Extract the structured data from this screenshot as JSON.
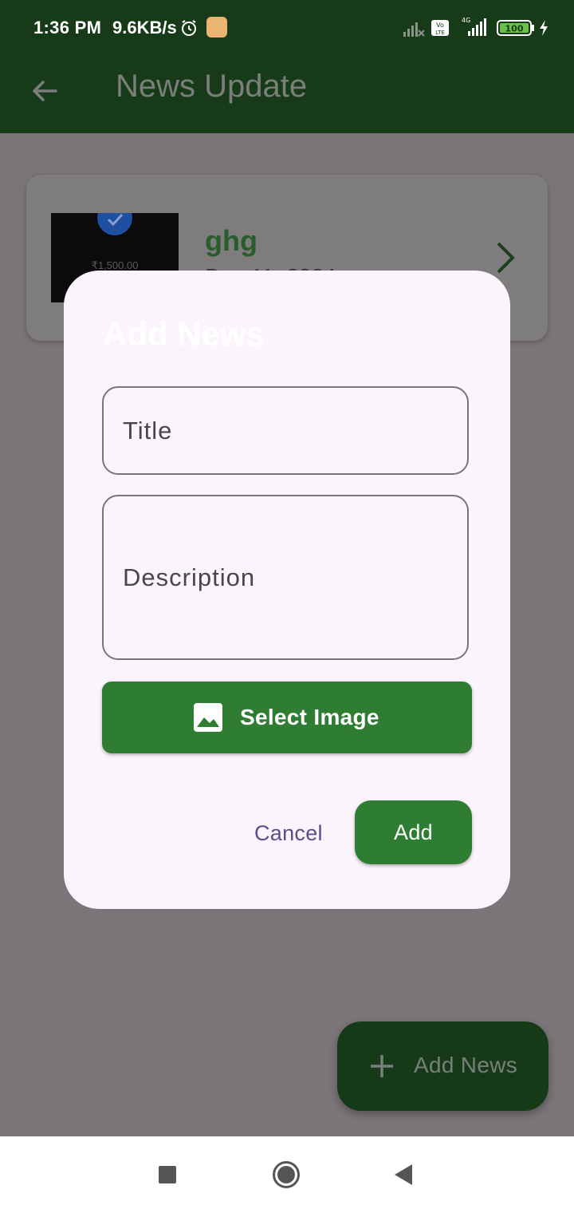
{
  "status_bar": {
    "time": "1:36 PM",
    "net_speed": "9.6KB/s",
    "battery_level": "100",
    "icons": [
      "alarm-icon",
      "app-notification-icon",
      "signal-icon",
      "volte-icon",
      "signal-4g-icon",
      "battery-icon",
      "charging-icon"
    ]
  },
  "app_bar": {
    "title": "News Update",
    "back_icon": "arrow-left-icon"
  },
  "news_list": [
    {
      "title": "ghg",
      "date": "Dec 11, 2024",
      "thumb_text": "₹1,500.00"
    }
  ],
  "fab": {
    "label": "Add News",
    "icon": "plus-icon"
  },
  "dialog": {
    "title": "Add News",
    "title_field": {
      "label": "Title"
    },
    "description_field": {
      "label": "Description"
    },
    "select_image": {
      "label": "Select Image",
      "icon": "image-icon"
    },
    "cancel_label": "Cancel",
    "add_label": "Add"
  },
  "colors": {
    "app_bar": "#173b19",
    "primary_button": "#2f7d33",
    "dialog_bg": "#fcf4fc",
    "scrim": "#7a7578",
    "accent_text": "#5d4d86"
  }
}
